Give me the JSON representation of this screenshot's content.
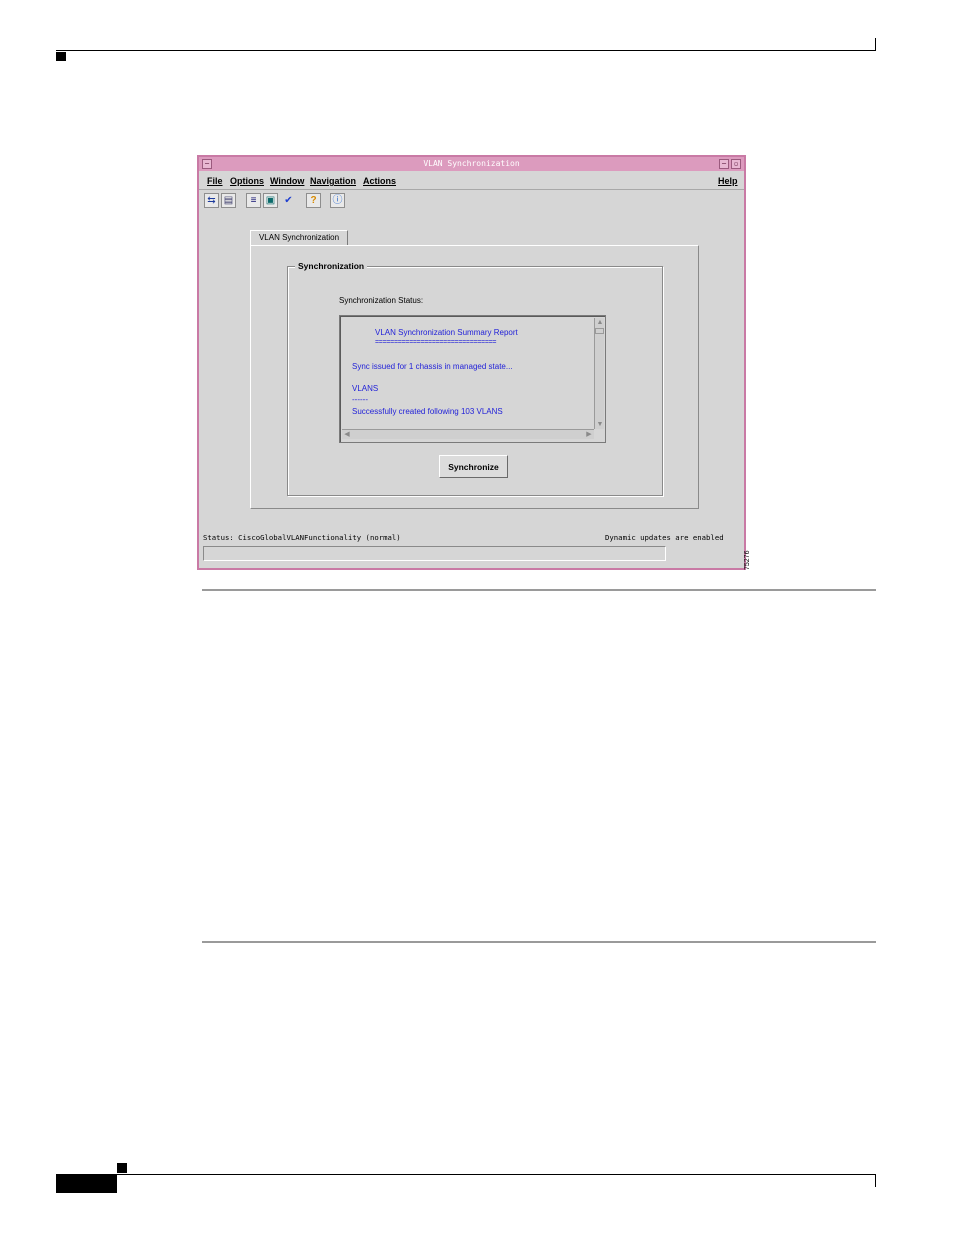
{
  "window": {
    "title": "VLAN Synchronization",
    "title_buttons": [
      "−",
      "▫"
    ],
    "menu": {
      "file": "File",
      "options": "Options",
      "window": "Window",
      "navigation": "Navigation",
      "actions": "Actions",
      "help": "Help"
    },
    "toolbar": {
      "icons": [
        "deployment-icon",
        "print-icon",
        "list-icon",
        "monitor-icon",
        "checkmark-icon",
        "help-icon",
        "info-icon"
      ],
      "glyphs": {
        "deploy": "⇆",
        "print": "▤",
        "list": "≡",
        "monitor": "▣",
        "check": "✔",
        "help": "?",
        "info": "ⓘ"
      }
    },
    "tab": {
      "label": "VLAN Synchronization"
    },
    "group": {
      "label": "Synchronization",
      "status_label": "Synchronization Status:",
      "report_lines": [
        "VLAN Synchronization Summary Report",
        "================================",
        "Sync issued for 1 chassis in managed state...",
        "VLANS",
        "------",
        "Successfully created following 103 VLANS"
      ]
    },
    "button": {
      "synchronize": "Synchronize"
    },
    "statusbar": {
      "left": "Status: CiscoGlobalVLANFunctionality (normal)",
      "right": "Dynamic updates are enabled"
    }
  },
  "figure_id": "75276"
}
